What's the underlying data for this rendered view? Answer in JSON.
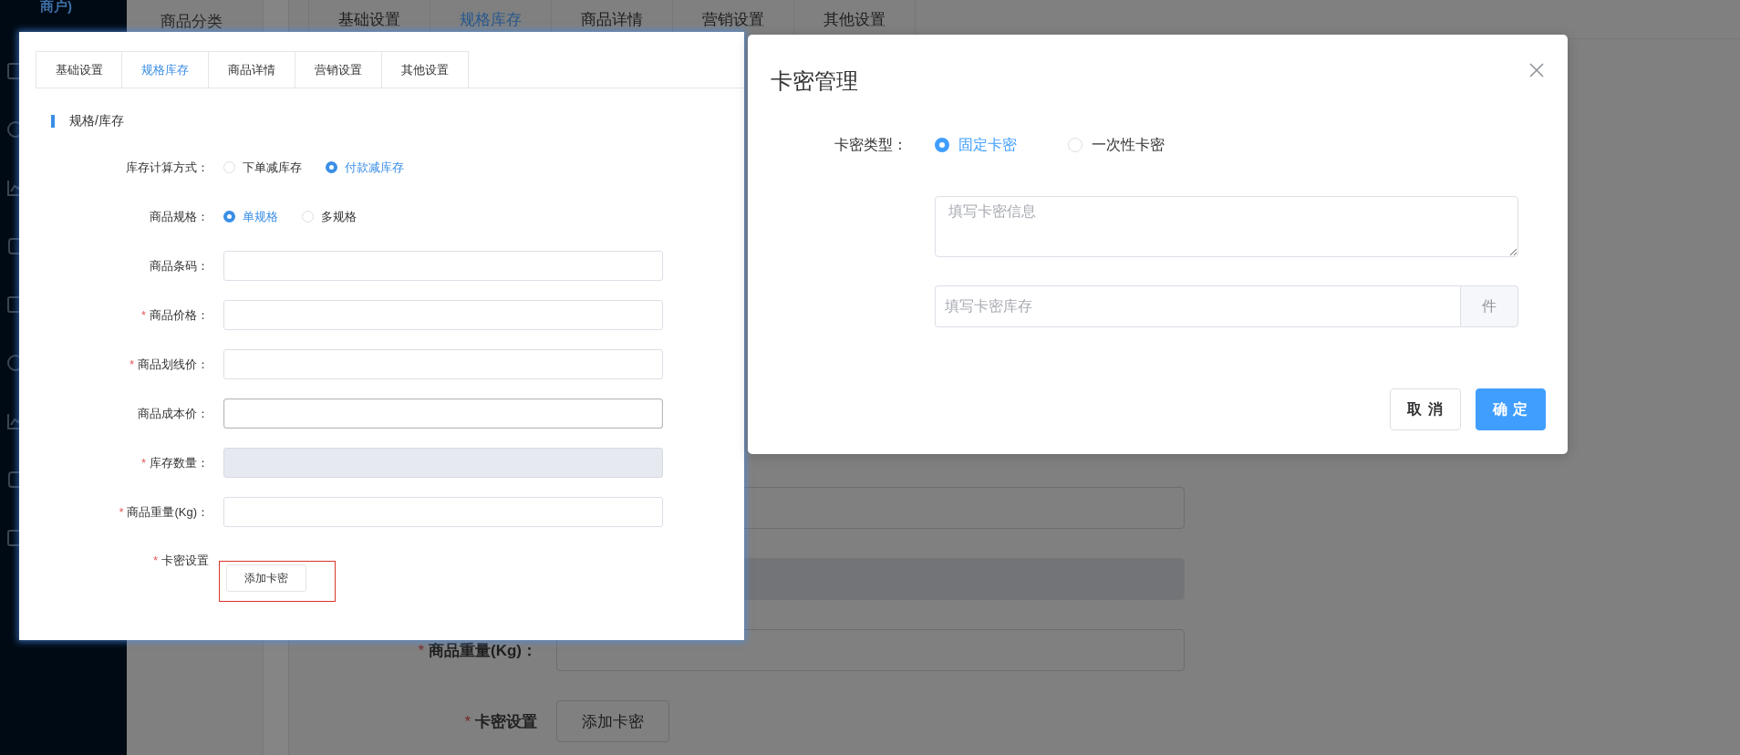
{
  "background": {
    "brand_text": "商户)",
    "side_menu_label": "商品分类",
    "tabs": [
      {
        "label": "基础设置",
        "selected": false
      },
      {
        "label": "规格库存",
        "selected": true
      },
      {
        "label": "商品详情",
        "selected": false
      },
      {
        "label": "营销设置",
        "selected": false
      },
      {
        "label": "其他设置",
        "selected": false
      }
    ],
    "form_rows": [
      {
        "kind": "input",
        "disabled": false
      },
      {
        "kind": "input",
        "disabled": true
      },
      {
        "kind": "input",
        "label": "商品重量(Kg)：",
        "asterisk": "*",
        "disabled": false
      },
      {
        "kind": "button",
        "label": "卡密设置",
        "asterisk": "*",
        "button": "添加卡密"
      }
    ]
  },
  "inset": {
    "tabs": [
      {
        "label": "基础设置",
        "selected": false
      },
      {
        "label": "规格库存",
        "selected": true
      },
      {
        "label": "商品详情",
        "selected": false
      },
      {
        "label": "营销设置",
        "selected": false
      },
      {
        "label": "其他设置",
        "selected": false
      }
    ],
    "section_title": "规格/库存",
    "rows": [
      {
        "kind": "radio",
        "label": "库存计算方式：",
        "options": [
          {
            "label": "下单减库存",
            "selected": false
          },
          {
            "label": "付款减库存",
            "selected": true
          }
        ]
      },
      {
        "kind": "radio",
        "label": "商品规格：",
        "options": [
          {
            "label": "单规格",
            "selected": true
          },
          {
            "label": "多规格",
            "selected": false
          }
        ]
      },
      {
        "kind": "input",
        "label": "商品条码：",
        "disabled": false,
        "focused": false
      },
      {
        "kind": "input",
        "label": "商品价格：",
        "asterisk": "*",
        "disabled": false,
        "focused": false
      },
      {
        "kind": "input",
        "label": "商品划线价：",
        "asterisk": "*",
        "disabled": false,
        "focused": false
      },
      {
        "kind": "input",
        "label": "商品成本价：",
        "disabled": false,
        "focused": true
      },
      {
        "kind": "input",
        "label": "库存数量：",
        "asterisk": "*",
        "disabled": true,
        "focused": false
      },
      {
        "kind": "input",
        "label": "商品重量(Kg)：",
        "asterisk": "*",
        "disabled": false,
        "focused": false
      },
      {
        "kind": "button",
        "label": "卡密设置",
        "asterisk": "*",
        "button": "添加卡密",
        "highlighted": true
      }
    ]
  },
  "dialog": {
    "title": "卡密管理",
    "type_label": "卡密类型：",
    "options": [
      {
        "label": "固定卡密",
        "selected": true
      },
      {
        "label": "一次性卡密",
        "selected": false
      }
    ],
    "textarea": {
      "placeholder": "填写卡密信息"
    },
    "stock_input": {
      "placeholder": "填写卡密库存",
      "suffix": "件"
    },
    "buttons": [
      {
        "label": "取 消",
        "kind": "default"
      },
      {
        "label": "确 定",
        "kind": "primary"
      }
    ]
  }
}
